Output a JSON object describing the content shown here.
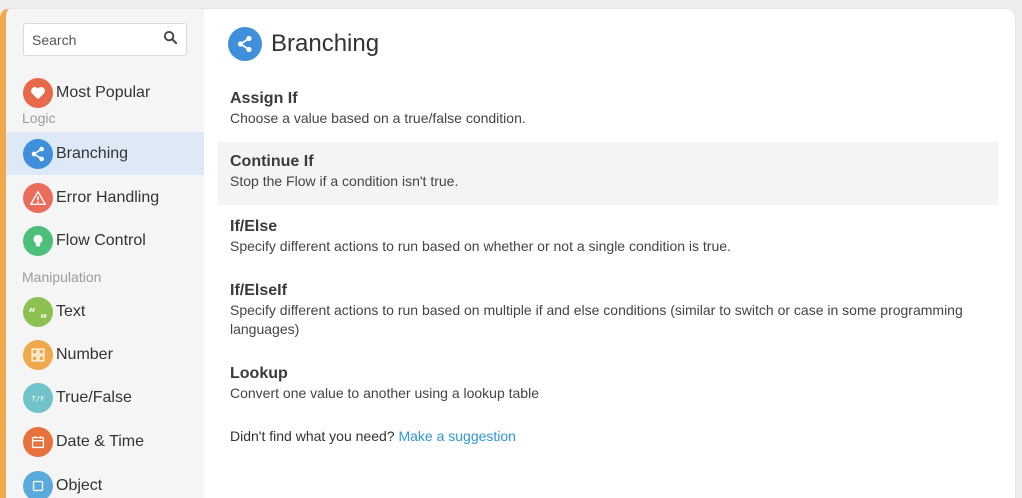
{
  "search": {
    "placeholder": "Search"
  },
  "sidebar": {
    "most_popular": {
      "label": "Most Popular",
      "icon": "heart-icon",
      "color": "#e8684a"
    },
    "sections": [
      {
        "label": "Logic",
        "items": [
          {
            "label": "Branching",
            "icon": "share-icon",
            "color": "#3f8fdb",
            "active": true
          },
          {
            "label": "Error Handling",
            "icon": "warning-icon",
            "color": "#ea6d5c"
          },
          {
            "label": "Flow Control",
            "icon": "lightbulb-icon",
            "color": "#4cc07a"
          }
        ]
      },
      {
        "label": "Manipulation",
        "items": [
          {
            "label": "Text",
            "icon": "quote-icon",
            "color": "#8cc152"
          },
          {
            "label": "Number",
            "icon": "number-grid-icon",
            "color": "#f0a94a"
          },
          {
            "label": "True/False",
            "icon": "true-false-icon",
            "color": "#6fc3c9"
          },
          {
            "label": "Date & Time",
            "icon": "calendar-icon",
            "color": "#e9713c"
          },
          {
            "label": "Object",
            "icon": "object-icon",
            "color": "#5aa9dd"
          }
        ]
      }
    ]
  },
  "main": {
    "title": "Branching",
    "title_icon": "share-icon",
    "entries": [
      {
        "name": "Assign If",
        "desc": "Choose a value based on a true/false condition."
      },
      {
        "name": "Continue If",
        "desc": "Stop the Flow if a condition isn't true."
      },
      {
        "name": "If/Else",
        "desc": "Specify different actions to run based on whether or not a single condition is true."
      },
      {
        "name": "If/ElseIf",
        "desc": "Specify different actions to run based on multiple if and else conditions (similar to switch or case in some programming languages)"
      },
      {
        "name": "Lookup",
        "desc": "Convert one value to another using a lookup table"
      }
    ],
    "footer_text": "Didn't find what you need?",
    "footer_link": "Make a suggestion"
  }
}
